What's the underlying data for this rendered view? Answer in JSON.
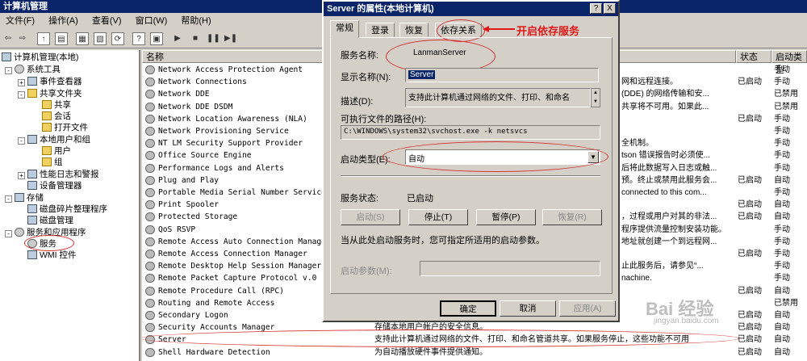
{
  "window": {
    "title": "计算机管理"
  },
  "menu": [
    "文件(F)",
    "操作(A)",
    "查看(V)",
    "窗口(W)",
    "帮助(H)"
  ],
  "tree": {
    "root": "计算机管理(本地)",
    "system_tools": "系统工具",
    "event_viewer": "事件查看器",
    "shared_folders": "共享文件夹",
    "shares": "共享",
    "sessions": "会话",
    "open_files": "打开文件",
    "local_users": "本地用户和组",
    "users": "用户",
    "groups": "组",
    "perf_logs": "性能日志和警报",
    "device_manager": "设备管理器",
    "storage": "存储",
    "defrag": "磁盘碎片整理程序",
    "disk_mgmt": "磁盘管理",
    "services_apps": "服务和应用程序",
    "services": "服务",
    "wmi": "WMI 控件"
  },
  "columns": {
    "name": "名称",
    "status": "状态",
    "startup": "启动类型"
  },
  "services": [
    {
      "name": "Network Access Protection Agent",
      "desc": "",
      "desc2": "",
      "status": "",
      "startup": "手动"
    },
    {
      "name": "Network Connections",
      "desc": "",
      "desc2": "网和远程连接。",
      "status": "已启动",
      "startup": "手动"
    },
    {
      "name": "Network DDE",
      "desc": "",
      "desc2": "(DDE) 的网络传输和安...",
      "status": "",
      "startup": "已禁用"
    },
    {
      "name": "Network DDE DSDM",
      "desc": "",
      "desc2": "共享将不可用。如果此...",
      "status": "",
      "startup": "已禁用"
    },
    {
      "name": "Network Location Awareness (NLA)",
      "desc": "",
      "desc2": "",
      "status": "已启动",
      "startup": "手动"
    },
    {
      "name": "Network Provisioning Service",
      "desc": "",
      "desc2": "",
      "status": "",
      "startup": "手动"
    },
    {
      "name": "NT LM Security Support Provider",
      "desc": "",
      "desc2": "全机制。",
      "status": "",
      "startup": "手动"
    },
    {
      "name": "Office Source Engine",
      "desc": "",
      "desc2": "tson 错误报告时必须使...",
      "status": "",
      "startup": "手动"
    },
    {
      "name": "Performance Logs and Alerts",
      "desc": "",
      "desc2": "后将此数据写入日志或触...",
      "status": "",
      "startup": "手动"
    },
    {
      "name": "Plug and Play",
      "desc": "",
      "desc2": "预。终止或禁用此服务会...",
      "status": "已启动",
      "startup": "自动"
    },
    {
      "name": "Portable Media Serial Number Service",
      "desc": "",
      "desc2": "connected to this com...",
      "status": "",
      "startup": "手动"
    },
    {
      "name": "Print Spooler",
      "desc": "",
      "desc2": "",
      "status": "已启动",
      "startup": "自动"
    },
    {
      "name": "Protected Storage",
      "desc": "",
      "desc2": "，过程或用户对其的非法...",
      "status": "已启动",
      "startup": "自动"
    },
    {
      "name": "QoS RSVP",
      "desc": "",
      "desc2": "程序提供流量控制安装功能。",
      "status": "",
      "startup": "手动"
    },
    {
      "name": "Remote Access Auto Connection Manager",
      "desc": "",
      "desc2": "地址就创建一个到远程网...",
      "status": "",
      "startup": "手动"
    },
    {
      "name": "Remote Access Connection Manager",
      "desc": "",
      "desc2": "",
      "status": "已启动",
      "startup": "手动"
    },
    {
      "name": "Remote Desktop Help Session Manager",
      "desc": "",
      "desc2": "止此服务后，请参见“...",
      "status": "",
      "startup": "手动"
    },
    {
      "name": "Remote Packet Capture Protocol v.0 (ex",
      "desc": "",
      "desc2": "nachine.",
      "status": "",
      "startup": "手动"
    },
    {
      "name": "Remote Procedure Call (RPC)",
      "desc": "",
      "desc2": "",
      "status": "已启动",
      "startup": "自动"
    },
    {
      "name": "Routing and Remote Access",
      "desc": "",
      "desc2": "",
      "status": "",
      "startup": "已禁用"
    },
    {
      "name": "Secondary Logon",
      "desc": "",
      "desc2": "",
      "status": "已启动",
      "startup": "自动"
    },
    {
      "name": "Security Accounts Manager",
      "desc": "存储本地用户帐户的安全信息。",
      "desc2": "",
      "status": "已启动",
      "startup": "自动"
    },
    {
      "name": "Server",
      "desc": "支持此计算机通过网络的文件、打印、和命名管道共享。如果服务停止，这些功能不可用",
      "desc2": "",
      "status": "已启动",
      "startup": "自动"
    },
    {
      "name": "Shell Hardware Detection",
      "desc": "为自动播放硬件事件提供通知。",
      "desc2": "",
      "status": "已启动",
      "startup": "自动"
    }
  ],
  "dialog": {
    "title": "Server 的属性(本地计算机)",
    "help": "?",
    "close": "X",
    "tabs": [
      "常规",
      "登录",
      "恢复",
      "依存关系"
    ],
    "service_name_label": "服务名称:",
    "service_name": "LanmanServer",
    "display_name_label": "显示名称(N):",
    "display_name": "Server",
    "description_label": "描述(D):",
    "description": "支持此计算机通过网络的文件、打印、和命名",
    "path_label": "可执行文件的路径(H):",
    "path": "C:\\WINDOWS\\system32\\svchost.exe -k netsvcs",
    "startup_label": "启动类型(E):",
    "startup_value": "自动",
    "status_label": "服务状态:",
    "status_value": "已启动",
    "btn_start": "启动(S)",
    "btn_stop": "停止(T)",
    "btn_pause": "暂停(P)",
    "btn_resume": "恢复(R)",
    "hint": "当从此处启动服务时，您可指定所适用的启动参数。",
    "params_label": "启动参数(M):",
    "ok": "确定",
    "cancel": "取消",
    "apply": "应用(A)"
  },
  "annotation": "开启依存服务",
  "watermark": {
    "main": "Bai 经验",
    "sub": "jingyan.baidu.com"
  }
}
